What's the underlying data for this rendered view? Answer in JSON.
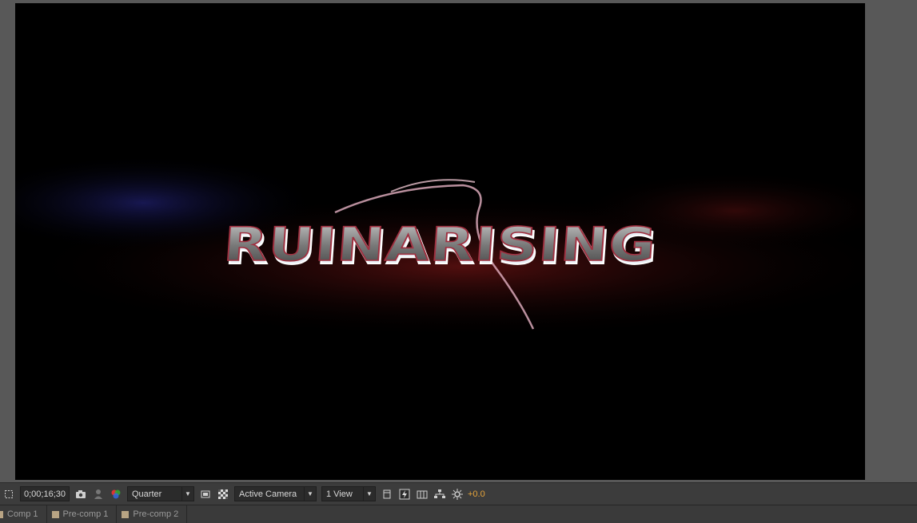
{
  "composition": {
    "title_text": "RUINARISING"
  },
  "toolbar": {
    "timecode": "0;00;16;30",
    "resolution": "Quarter",
    "camera": "Active Camera",
    "view_layout": "1 View",
    "exposure": "+0.0",
    "icons": [
      "region-of-interest-icon",
      "snapshot-icon",
      "show-snapshot-icon",
      "color-channel-icon",
      "toggle-mask-icon",
      "transparency-grid-icon",
      "3d-view-icon",
      "fast-preview-icon",
      "timeline-icon",
      "comp-flowchart-icon",
      "reset-exposure-icon"
    ]
  },
  "tabs": [
    {
      "label": "Comp 1"
    },
    {
      "label": "Pre-comp 1"
    },
    {
      "label": "Pre-comp 2"
    }
  ],
  "colors": {
    "accent_exposure": "#e6a43a",
    "tab_swatch": "#b8a484"
  }
}
